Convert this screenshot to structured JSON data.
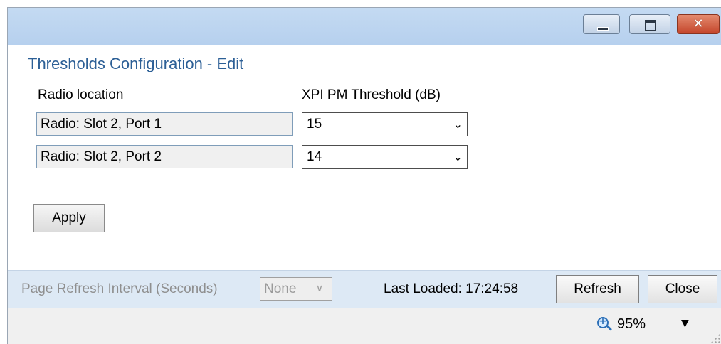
{
  "window": {
    "controls": {
      "minimize_icon": "minimize-icon",
      "maximize_icon": "maximize-icon",
      "close_icon": "close-icon",
      "close_glyph": "✕"
    }
  },
  "form": {
    "title": "Thresholds Configuration - Edit",
    "columns": {
      "location": "Radio location",
      "threshold": "XPI PM Threshold (dB)"
    },
    "rows": [
      {
        "location": "Radio: Slot 2, Port 1",
        "threshold": "15"
      },
      {
        "location": "Radio: Slot 2, Port 2",
        "threshold": "14"
      }
    ],
    "apply_label": "Apply"
  },
  "footer": {
    "refresh_interval_label": "Page Refresh Interval (Seconds)",
    "refresh_interval_value": "None",
    "last_loaded": "Last Loaded: 17:24:58",
    "refresh_label": "Refresh",
    "close_label": "Close"
  },
  "statusbar": {
    "zoom_icon": "zoom-icon",
    "zoom_level": "95%",
    "zoom_menu_glyph": "▼"
  },
  "colors": {
    "title_text": "#2c5f96",
    "titlebar": "#c4daf2",
    "footer_bg": "#dde9f5",
    "close_button": "#c4462b"
  }
}
